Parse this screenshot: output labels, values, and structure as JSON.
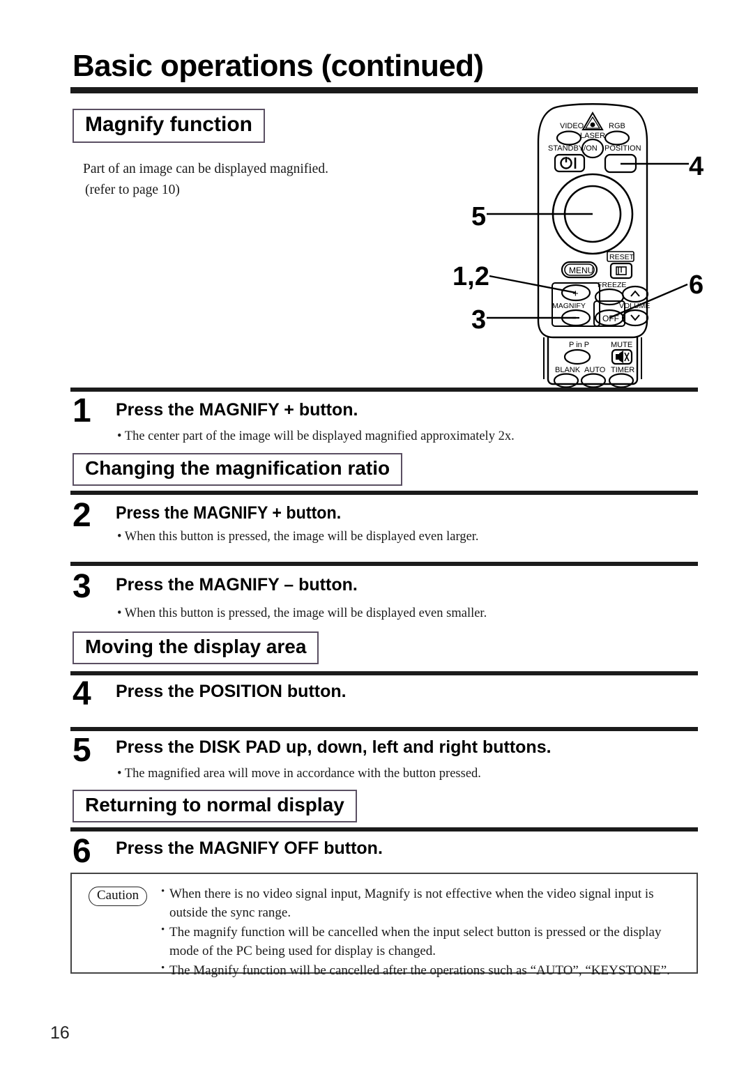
{
  "document": {
    "title": "Basic operations (continued)",
    "page_number": "16"
  },
  "sections": [
    {
      "heading": "Magnify function",
      "intro_line1": "Part of an image can be displayed magnified.",
      "intro_line2": "(refer to page 10)"
    },
    {
      "heading": "Changing the magnification ratio"
    },
    {
      "heading": "Moving the display area"
    },
    {
      "heading": "Returning to normal display"
    }
  ],
  "steps": [
    {
      "number": "1",
      "title": "Press the MAGNIFY + button.",
      "bullet": "• The center part of the image will be displayed magnified approximately 2x."
    },
    {
      "number": "2",
      "title": "Press the MAGNIFY + button.",
      "bullet": "• When this button is pressed, the image will be displayed even larger."
    },
    {
      "number": "3",
      "title": "Press the MAGNIFY – button.",
      "bullet": "• When this button is pressed, the image will be displayed even smaller."
    },
    {
      "number": "4",
      "title": "Press the POSITION button.",
      "bullet": ""
    },
    {
      "number": "5",
      "title": "Press the DISK PAD up, down, left and right buttons.",
      "bullet": "• The magnified area will move in accordance with the button pressed."
    },
    {
      "number": "6",
      "title": "Press the MAGNIFY OFF button.",
      "bullet": ""
    }
  ],
  "caution": {
    "label": "Caution",
    "items": [
      "When there is no video signal input, Magnify is not effective when the video signal input is outside the sync range.",
      "The magnify function will be cancelled when the input select button is pressed or the display mode of the PC being used for display is changed.",
      "The Magnify function will be cancelled after the operations such as “AUTO”, “KEYSTONE”."
    ]
  },
  "remote": {
    "callouts": [
      {
        "label": "4"
      },
      {
        "label": "5"
      },
      {
        "label": "1,2"
      },
      {
        "label": "3"
      },
      {
        "label": "6"
      }
    ],
    "buttons": {
      "video": "VIDEO",
      "laser": "LASER",
      "rgb": "RGB",
      "standby_on": "STANDBY/ON",
      "position": "POSITION",
      "menu": "MENU",
      "reset": "RESET",
      "freeze": "FREEZE",
      "magnify": "MAGNIFY",
      "volume": "VOLUME",
      "magnify_off": "OFF",
      "magnify_plus": "+",
      "magnify_minus": "–",
      "p_in_p": "P in P",
      "mute": "MUTE",
      "blank": "BLANK",
      "auto": "AUTO",
      "timer": "TIMER"
    }
  }
}
